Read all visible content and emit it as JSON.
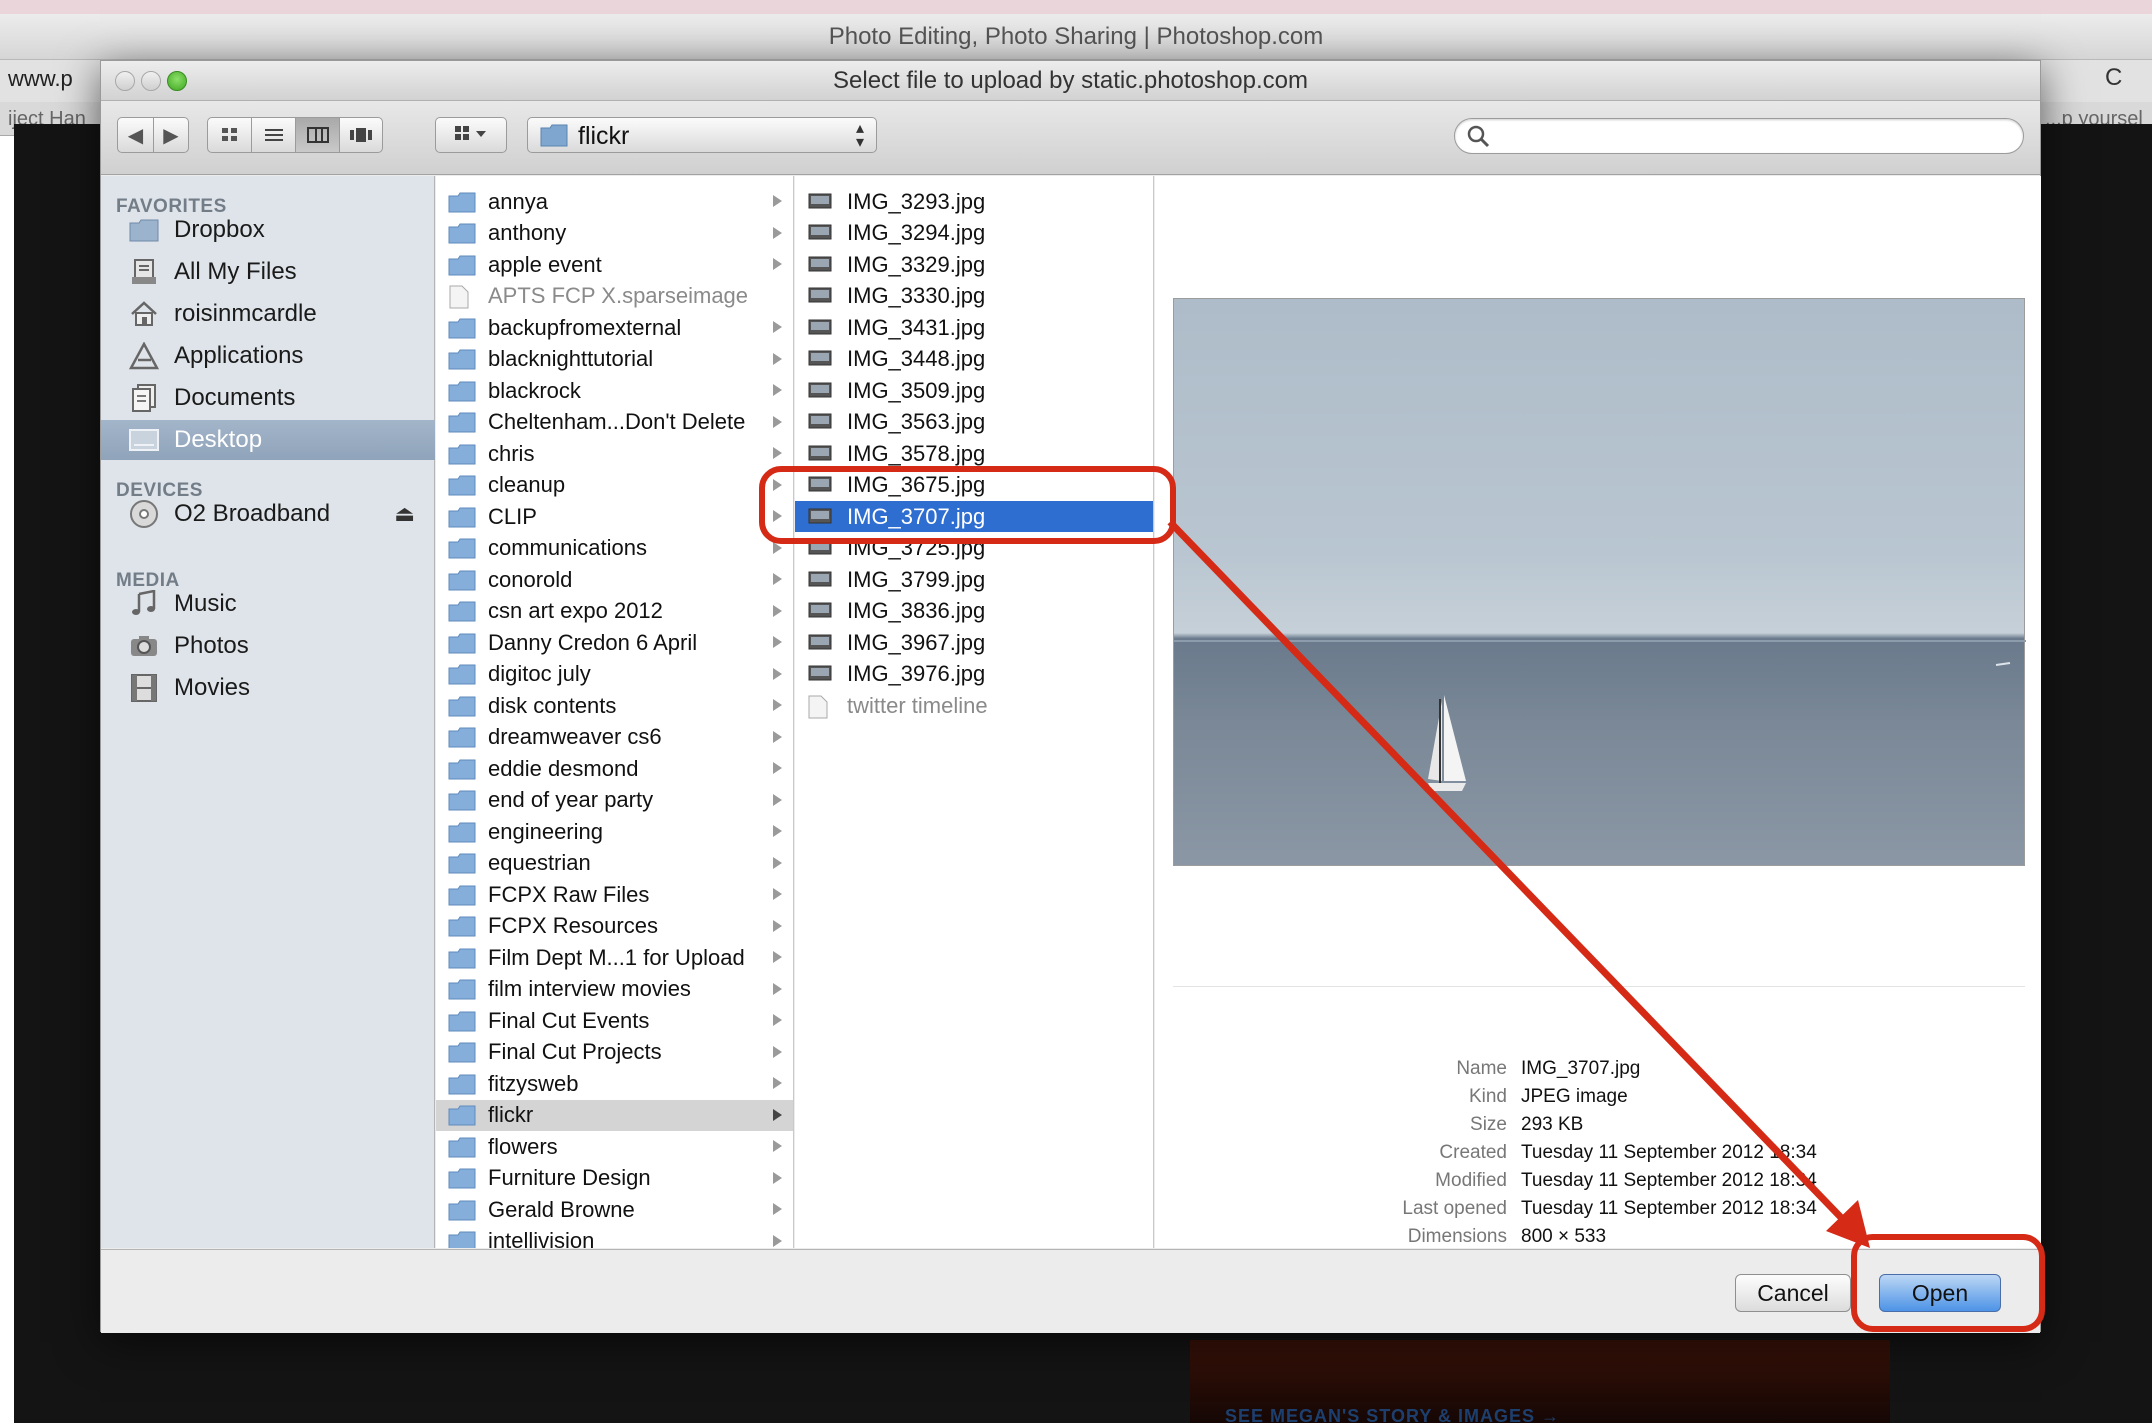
{
  "browser": {
    "window_title": "Photo Editing, Photo Sharing | Photoshop.com",
    "url_fragment": "www.p",
    "url_right_icon": "C",
    "bookmark_left": "iject Han",
    "bookmark_right": "...p yoursel",
    "background_bottom_text": "SEE MEGAN'S STORY & IMAGES →"
  },
  "dialog": {
    "title": "Select file to upload by static.photoshop.com",
    "toolbar": {
      "back_icon": "back-arrow-icon",
      "forward_icon": "forward-arrow-icon",
      "view_modes": [
        "icon-view",
        "list-view",
        "column-view",
        "coverflow-view"
      ],
      "active_view": "column-view",
      "arrange_icon": "arrange-icon",
      "path_popup": "flickr",
      "search_placeholder": ""
    },
    "sidebar": {
      "favorites_header": "FAVORITES",
      "favorites": [
        {
          "label": "Dropbox",
          "icon": "folder-icon"
        },
        {
          "label": "All My Files",
          "icon": "all-files-icon"
        },
        {
          "label": "roisinmcardle",
          "icon": "home-icon"
        },
        {
          "label": "Applications",
          "icon": "applications-icon"
        },
        {
          "label": "Documents",
          "icon": "documents-icon"
        },
        {
          "label": "Desktop",
          "icon": "desktop-icon",
          "selected": true
        }
      ],
      "devices_header": "DEVICES",
      "devices": [
        {
          "label": "O2 Broadband",
          "icon": "disk-icon",
          "eject": "⏏"
        }
      ],
      "media_header": "MEDIA",
      "media": [
        {
          "label": "Music",
          "icon": "music-icon"
        },
        {
          "label": "Photos",
          "icon": "camera-icon"
        },
        {
          "label": "Movies",
          "icon": "film-icon"
        }
      ]
    },
    "column1": [
      "annya",
      "anthony",
      "apple event",
      "APTS FCP X.sparseimage",
      "backupfromexternal",
      "blacknighttutorial",
      "blackrock",
      "Cheltenham...Don't Delete",
      "chris",
      "cleanup",
      "CLIP",
      "communications",
      "conorold",
      "csn art expo 2012",
      "Danny Credon 6 April",
      "digitoc july",
      "disk contents",
      "dreamweaver cs6",
      "eddie desmond",
      "end of year party",
      "engineering",
      "equestrian",
      "FCPX Raw Files",
      "FCPX Resources",
      "Film Dept M...1 for Upload",
      "film interview movies",
      "Final Cut Events",
      "Final Cut Projects",
      "fitzysweb",
      "flickr",
      "flowers",
      "Furniture Design",
      "Gerald Browne",
      "intellivision"
    ],
    "column1_special": {
      "file_item": "APTS FCP X.sparseimage",
      "path_selected": "flickr"
    },
    "column2": [
      "IMG_3293.jpg",
      "IMG_3294.jpg",
      "IMG_3329.jpg",
      "IMG_3330.jpg",
      "IMG_3431.jpg",
      "IMG_3448.jpg",
      "IMG_3509.jpg",
      "IMG_3563.jpg",
      "IMG_3578.jpg",
      "IMG_3675.jpg",
      "IMG_3707.jpg",
      "IMG_3725.jpg",
      "IMG_3799.jpg",
      "IMG_3836.jpg",
      "IMG_3967.jpg",
      "IMG_3976.jpg",
      "twitter timeline"
    ],
    "column2_special": {
      "selected": "IMG_3707.jpg",
      "dim_item": "twitter timeline"
    },
    "info": {
      "labels": [
        "Name",
        "Kind",
        "Size",
        "Created",
        "Modified",
        "Last opened",
        "Dimensions"
      ],
      "values": [
        "IMG_3707.jpg",
        "JPEG image",
        "293 KB",
        "Tuesday 11 September 2012 18:34",
        "Tuesday 11 September 2012 18:34",
        "Tuesday 11 September 2012 18:34",
        "800 × 533"
      ]
    },
    "buttons": {
      "cancel": "Cancel",
      "open": "Open"
    }
  },
  "colors": {
    "sidebar_bg": "#dfe4ea",
    "selection_blue": "#2f6ed1",
    "annotation_red": "#d42a16",
    "default_button": "#4d93e6"
  }
}
